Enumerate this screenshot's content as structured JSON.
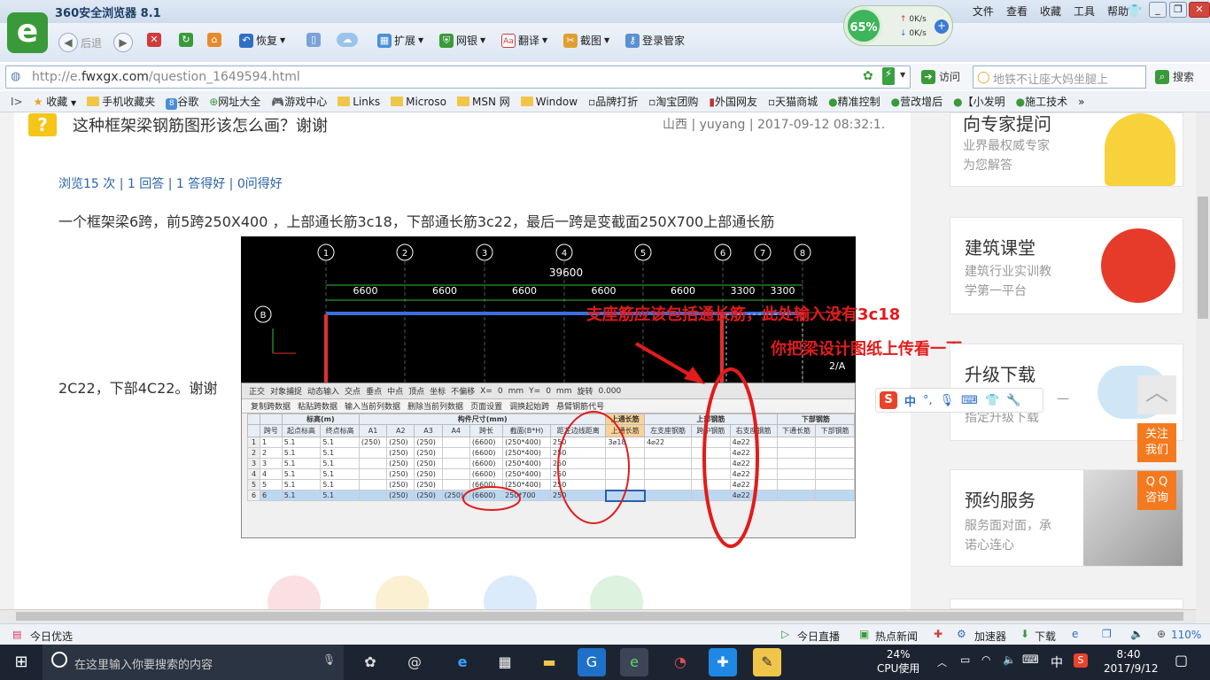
{
  "browser": {
    "title": "360安全浏览器 8.1",
    "menu": [
      "文件",
      "查看",
      "收藏",
      "工具",
      "帮助"
    ]
  },
  "toolbar": {
    "back": "后退",
    "restore": "恢复",
    "extend": "扩展",
    "netbank": "网银",
    "translate": "翻译",
    "screenshot": "截图",
    "login": "登录管家"
  },
  "perf": {
    "memory": "65%",
    "up": "0K/s",
    "down": "0K/s"
  },
  "address": {
    "prefix": "http://e.",
    "domain": "fwxgx.com",
    "path": "/question_1649594.html",
    "go": "访问",
    "search_placeholder": "地铁不让座大妈坐腿上",
    "search_btn": "搜索"
  },
  "bookmarks": [
    "收藏",
    "手机收藏夹",
    "谷歌",
    "网址大全",
    "游戏中心",
    "Links",
    "Microso",
    "MSN 网",
    "Window",
    "品牌打折",
    "淘宝团购",
    "外国网友",
    "天猫商城",
    "精准控制",
    "营改增后",
    "【小发明",
    "施工技术"
  ],
  "question": {
    "title": "这种框架梁钢筋图形该怎么画？谢谢",
    "author": "山西 | yuyang | 2017-09-12 08:32:1.",
    "stats": "浏览15 次 | 1 回答 | 1 答得好 | 0问得好",
    "body1": "一个框架梁6跨，前5跨250X400 ，上部通长筋3c18，下部通长筋3c22，最后一跨是变截面250X700上部通长筋",
    "body2": "2C22，下部4C22。谢谢"
  },
  "annotation": {
    "line1": "支座筋应该包括通长筋，此处输入没有3c18",
    "line2": "你把梁设计图纸上传看一下"
  },
  "cad": {
    "axes": [
      "1",
      "2",
      "3",
      "4",
      "5",
      "6",
      "7",
      "8"
    ],
    "total": "39600",
    "spans": [
      "6600",
      "6600",
      "6600",
      "6600",
      "6600",
      "3300",
      "3300"
    ],
    "row_b": "B",
    "row_2a": "2/A"
  },
  "grid": {
    "tools": [
      "正交",
      "对象捕捉",
      "动态输入",
      "交点",
      "垂点",
      "中点",
      "顶点",
      "坐标",
      "不偏移",
      "X=",
      "0",
      "mm",
      "Y=",
      "0",
      "mm",
      "旋转",
      "0.000"
    ],
    "actions": [
      "复制跨数据",
      "粘贴跨数据",
      "输入当前列数据",
      "删除当前列数据",
      "页面设置",
      "调换起始跨",
      "悬臂钢筋代号"
    ],
    "group_headers": [
      "标高(m)",
      "构件尺寸(mm)",
      "上通长筋",
      "上部钢筋",
      "下部钢筋"
    ],
    "headers": [
      "跨号",
      "起点标高",
      "终点标高",
      "A1",
      "A2",
      "A3",
      "A4",
      "跨长",
      "截面(B*H)",
      "距左边线距离",
      "上通长筋",
      "左支座钢筋",
      "跨中钢筋",
      "右支座钢筋",
      "下通长筋",
      "下部钢筋"
    ],
    "rows": [
      [
        "1",
        "5.1",
        "5.1",
        "(250)",
        "(250)",
        "(250)",
        "",
        "(6600)",
        "(250*400)",
        "250",
        "3⌀18",
        "4⌀22",
        "",
        "4⌀22",
        "",
        ""
      ],
      [
        "2",
        "5.1",
        "5.1",
        "",
        "(250)",
        "(250)",
        "",
        "(6600)",
        "(250*400)",
        "250",
        "",
        "",
        "",
        "4⌀22",
        "",
        ""
      ],
      [
        "3",
        "5.1",
        "5.1",
        "",
        "(250)",
        "(250)",
        "",
        "(6600)",
        "(250*400)",
        "250",
        "",
        "",
        "",
        "4⌀22",
        "",
        ""
      ],
      [
        "4",
        "5.1",
        "5.1",
        "",
        "(250)",
        "(250)",
        "",
        "(6600)",
        "(250*400)",
        "250",
        "",
        "",
        "",
        "4⌀22",
        "",
        ""
      ],
      [
        "5",
        "5.1",
        "5.1",
        "",
        "(250)",
        "(250)",
        "",
        "(6600)",
        "(250*400)",
        "250",
        "",
        "",
        "",
        "4⌀22",
        "",
        ""
      ],
      [
        "6",
        "5.1",
        "5.1",
        "",
        "(250)",
        "(250)",
        "(250)",
        "(6600)",
        "250*700",
        "250",
        "",
        "",
        "",
        "4⌀22",
        "",
        ""
      ]
    ]
  },
  "sidebar": [
    {
      "title": "向专家提问",
      "sub1": "业界最权威专家",
      "sub2": "为您解答"
    },
    {
      "title": "建筑课堂",
      "sub1": "建筑行业实训教",
      "sub2": "学第一平台"
    },
    {
      "title": "升级下载",
      "sub1": "一",
      "sub2": "指定升级下载"
    },
    {
      "title": "预约服务",
      "sub1": "服务面对面，承",
      "sub2": "诺心连心"
    }
  ],
  "float": {
    "follow": "关注\n我们",
    "qq": "Q Q\n咨询"
  },
  "ime": {
    "lang": "中"
  },
  "status": {
    "left": "今日优选",
    "live": "今日直播",
    "news": "热点新闻",
    "accel": "加速器",
    "download": "下载",
    "zoom": "110%"
  },
  "taskbar": {
    "search": "在这里输入你要搜索的内容",
    "cpu": "24%",
    "cpu_label": "CPU使用",
    "ime": "中",
    "time": "8:40",
    "date": "2017/9/12"
  }
}
